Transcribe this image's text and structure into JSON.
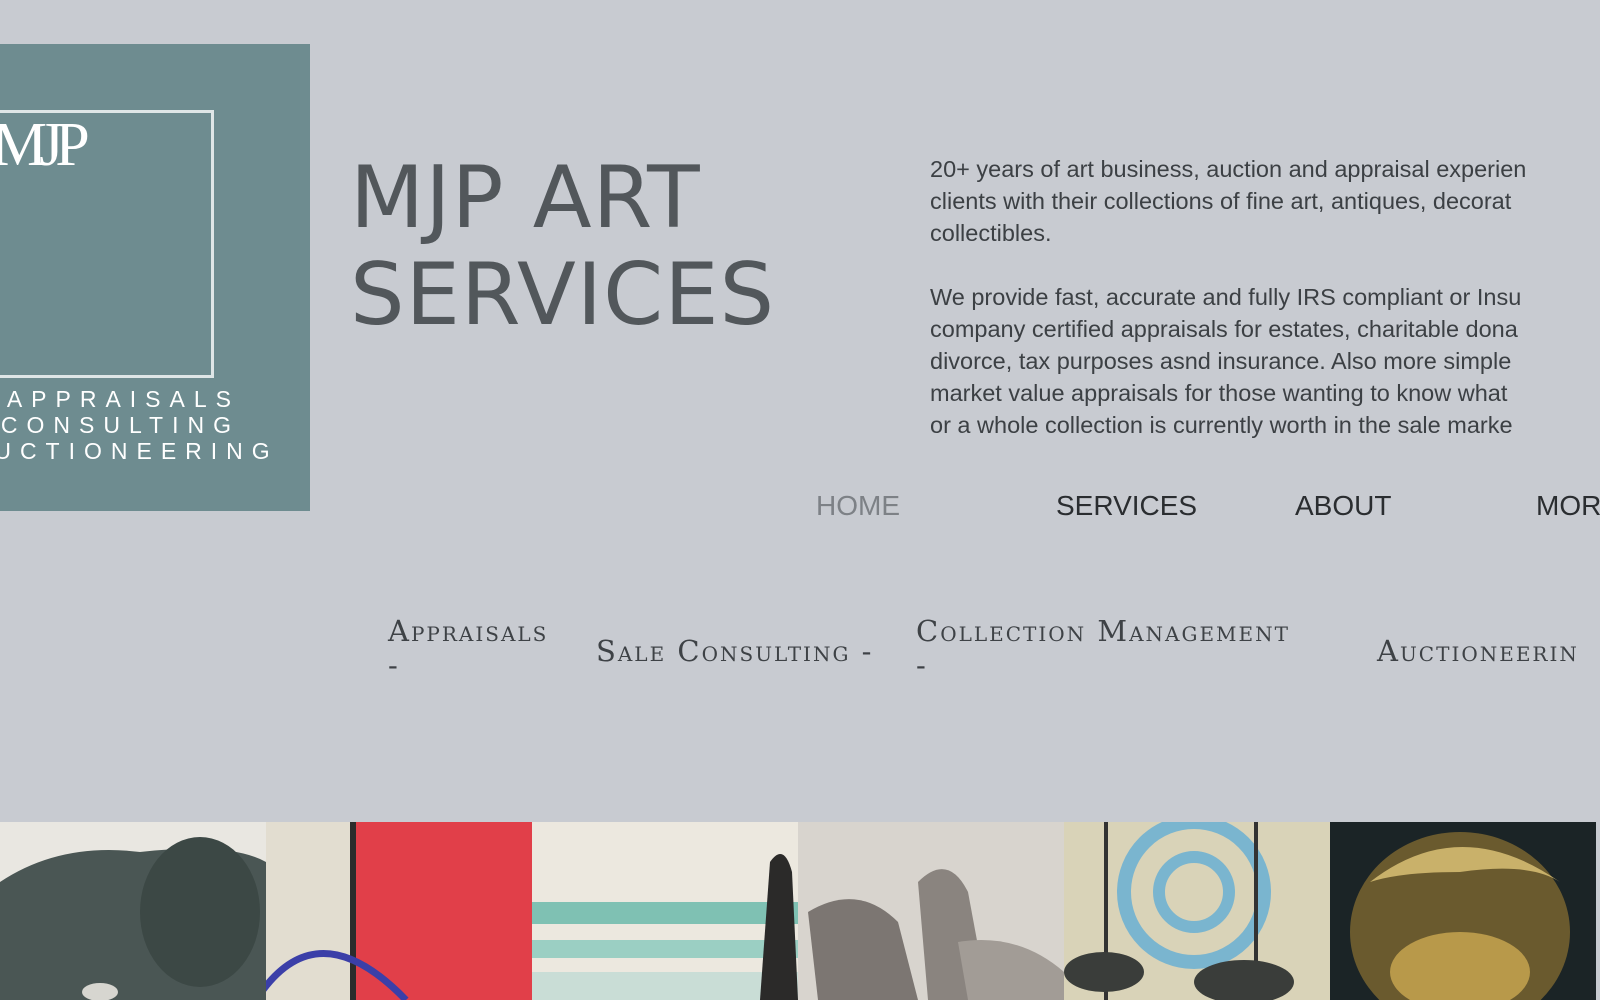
{
  "logo": {
    "mark": "MJP",
    "tagline": [
      "APPRAISALS",
      "CONSULTING",
      "AUCTIONEERING"
    ],
    "colors": {
      "background": "#6e8c90",
      "text": "#ffffff"
    }
  },
  "header": {
    "title_line1": "MJP ART",
    "title_line2": "SERVICES"
  },
  "intro": {
    "paragraph1": [
      "20+ years of art business, auction and appraisal experien",
      "clients with their collections of fine art, antiques, decorat",
      "collectibles."
    ],
    "paragraph2": [
      "We provide fast, accurate and fully IRS compliant or Insu",
      "company certified appraisals for estates, charitable dona",
      "divorce,  tax purposes asnd insurance.  Also more simple",
      "market  value appraisals for those wanting to know what",
      "or a whole collection is currently worth in the sale marke"
    ]
  },
  "nav": {
    "items": [
      {
        "label": "HOME",
        "active": true
      },
      {
        "label": "SERVICES",
        "active": false
      },
      {
        "label": "ABOUT",
        "active": false
      },
      {
        "label": "MOR",
        "active": false
      }
    ]
  },
  "subnav": {
    "appraisals_line1": "Appraisals",
    "appraisals_line2": "-",
    "sale_consulting": "Sale Consulting -",
    "collection_line1": "Collection Management",
    "collection_line2": "-",
    "auctioneering": "Auctioneerin"
  },
  "gallery": {
    "tiles": [
      "elephant-sculpture",
      "abstract-red-painting",
      "seascape-painting",
      "hand-drawing",
      "blue-print-artwork",
      "bronze-bust"
    ]
  },
  "colors": {
    "page_background": "#c8cbd1",
    "title_text": "#52575b",
    "nav_active": "#7d8186"
  }
}
